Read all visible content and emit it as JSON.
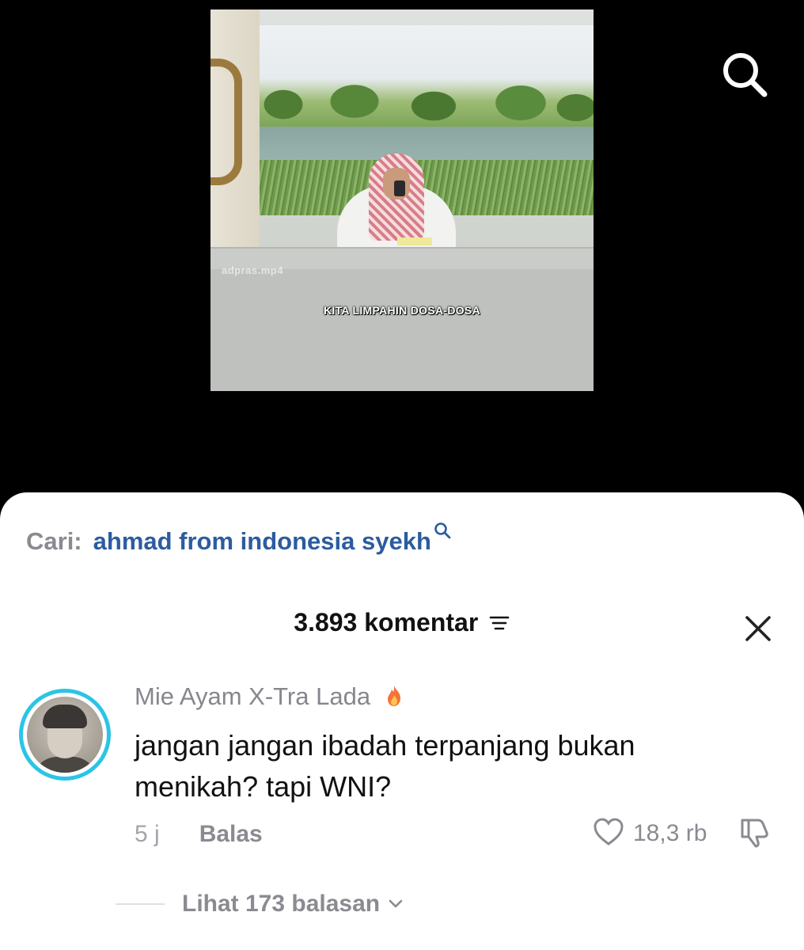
{
  "video": {
    "watermark": "adpras.mp4",
    "caption": "KITA LIMPAHIN DOSA-DOSA"
  },
  "search": {
    "prefix": "Cari:",
    "query": "ahmad from indonesia syekh"
  },
  "comments_header": {
    "count_label": "3.893 komentar"
  },
  "comment": {
    "username": "Mie Ayam X-Tra Lada",
    "text": "jangan jangan ibadah terpanjang bukan menikah? tapi WNI?",
    "time": "5 j",
    "reply_label": "Balas",
    "like_count": "18,3 rb",
    "view_replies_label": "Lihat 173 balasan"
  },
  "icons": {
    "search": "search-icon",
    "mini_search": "search-icon",
    "sort": "sort-icon",
    "close": "close-icon",
    "fire": "fire-icon",
    "like": "heart-icon",
    "dislike": "thumbs-down-icon",
    "chevron": "chevron-down-icon"
  },
  "colors": {
    "query_link": "#2c5c9e",
    "avatar_ring": "#2cc4e6",
    "muted_text": "#8a8b91",
    "background_top": "#000000",
    "sheet": "#ffffff"
  }
}
